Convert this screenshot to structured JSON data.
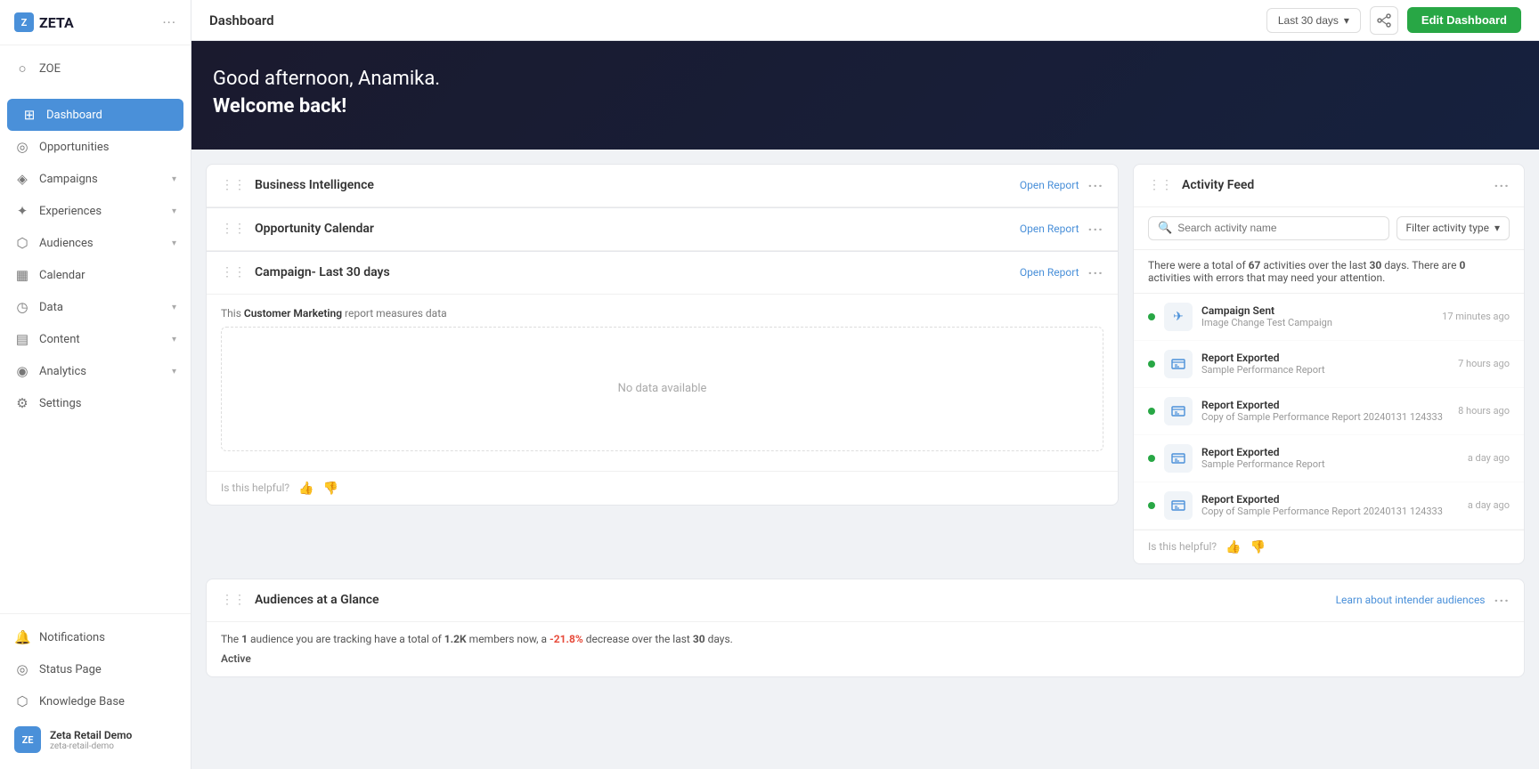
{
  "app": {
    "logo": "Z",
    "name": "ZETA",
    "more_icon": "···"
  },
  "sidebar": {
    "zoe_label": "ZOE",
    "items": [
      {
        "id": "dashboard",
        "label": "Dashboard",
        "icon": "⊞",
        "active": true,
        "has_chevron": false
      },
      {
        "id": "opportunities",
        "label": "Opportunities",
        "icon": "○",
        "active": false,
        "has_chevron": false
      },
      {
        "id": "campaigns",
        "label": "Campaigns",
        "icon": "◈",
        "active": false,
        "has_chevron": true
      },
      {
        "id": "experiences",
        "label": "Experiences",
        "icon": "✦",
        "active": false,
        "has_chevron": true
      },
      {
        "id": "audiences",
        "label": "Audiences",
        "icon": "⬡",
        "active": false,
        "has_chevron": true
      },
      {
        "id": "calendar",
        "label": "Calendar",
        "icon": "▦",
        "active": false,
        "has_chevron": false
      },
      {
        "id": "data",
        "label": "Data",
        "icon": "◷",
        "active": false,
        "has_chevron": true
      },
      {
        "id": "content",
        "label": "Content",
        "icon": "▤",
        "active": false,
        "has_chevron": true
      },
      {
        "id": "analytics",
        "label": "Analytics",
        "icon": "◉",
        "active": false,
        "has_chevron": true
      },
      {
        "id": "settings",
        "label": "Settings",
        "icon": "⚙",
        "active": false,
        "has_chevron": false
      }
    ],
    "footer_items": [
      {
        "id": "notifications",
        "label": "Notifications",
        "icon": "🔔"
      },
      {
        "id": "status",
        "label": "Status Page",
        "icon": "◎"
      },
      {
        "id": "knowledge",
        "label": "Knowledge Base",
        "icon": "⬡"
      }
    ],
    "user": {
      "initials": "ZE",
      "name": "Zeta Retail Demo",
      "slug": "zeta-retail-demo"
    }
  },
  "topbar": {
    "title": "Dashboard",
    "date_range": "Last 30 days",
    "edit_dashboard": "Edit Dashboard"
  },
  "greeting": {
    "line1": "Good afternoon, Anamika.",
    "line2": "Welcome back!"
  },
  "business_intelligence": {
    "title": "Business Intelligence",
    "open_report": "Open Report"
  },
  "opportunity_calendar": {
    "title": "Opportunity Calendar",
    "open_report": "Open Report"
  },
  "campaign_report": {
    "title": "Campaign- Last 30 days",
    "open_report": "Open Report",
    "description_pre": "This ",
    "description_bold": "Customer Marketing",
    "description_post": " report measures data",
    "no_data": "No data available",
    "helpful_label": "Is this helpful?"
  },
  "activity_feed": {
    "title": "Activity Feed",
    "search_placeholder": "Search activity name",
    "filter_placeholder": "Filter activity type",
    "summary_pre": "There were a total of ",
    "total_activities": "67",
    "summary_mid": " activities over the last ",
    "last_days": "30",
    "summary_post": " days. There are ",
    "error_count": "0",
    "summary_end": " activities with errors that may need your attention.",
    "items": [
      {
        "id": 1,
        "name": "Campaign Sent",
        "sub": "Image Change  Test Campaign",
        "time": "17 minutes ago",
        "icon": "✈",
        "type": "campaign"
      },
      {
        "id": 2,
        "name": "Report Exported",
        "sub": "Sample Performance Report",
        "time": "7 hours ago",
        "icon": "📊",
        "type": "report"
      },
      {
        "id": 3,
        "name": "Report Exported",
        "sub": "Copy of Sample Performance Report 20240131  124333",
        "time": "8 hours ago",
        "icon": "📊",
        "type": "report"
      },
      {
        "id": 4,
        "name": "Report Exported",
        "sub": "Sample Performance Report",
        "time": "a day ago",
        "icon": "📊",
        "type": "report"
      },
      {
        "id": 5,
        "name": "Report Exported",
        "sub": "Copy of Sample Performance Report 20240131  124333",
        "time": "a day ago",
        "icon": "📊",
        "type": "report"
      }
    ],
    "helpful_label": "Is this helpful?"
  },
  "audiences": {
    "title": "Audiences at a Glance",
    "learn_link": "Learn about intender audiences",
    "summary_pre": "The ",
    "count": "1",
    "summary_mid": " audience you are tracking have a total of ",
    "members": "1.2K",
    "summary_post": " members now, a ",
    "change": "-21.8%",
    "summary_end": " decrease over the last ",
    "days": "30",
    "summary_final": " days.",
    "active_label": "Active"
  }
}
